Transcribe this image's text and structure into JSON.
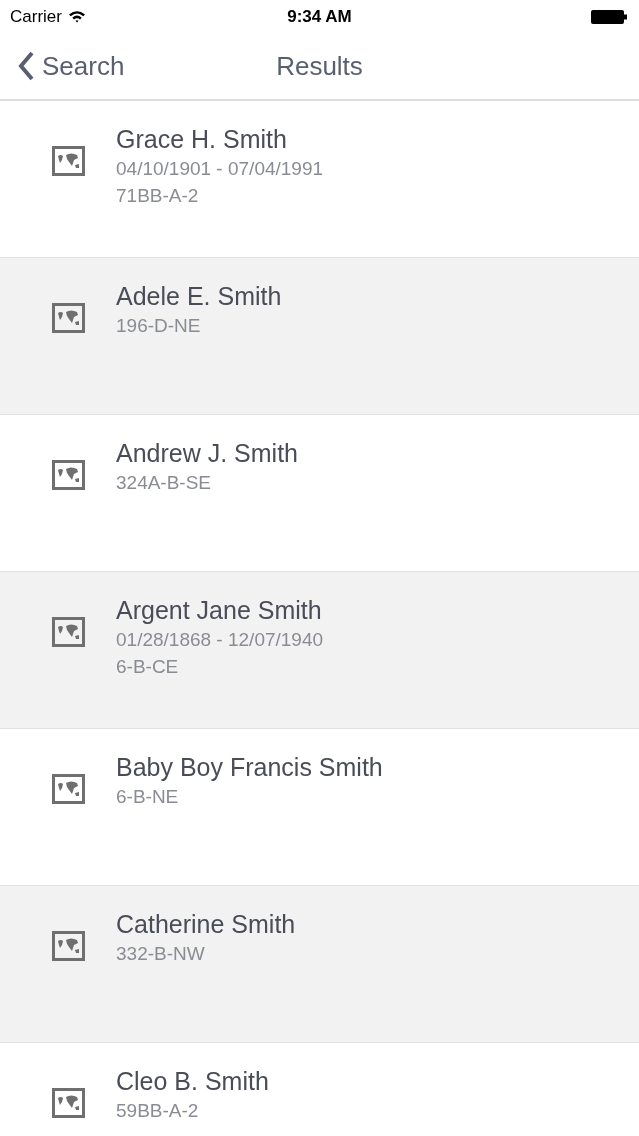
{
  "status_bar": {
    "carrier": "Carrier",
    "time": "9:34 AM"
  },
  "nav": {
    "back": "Search",
    "title": "Results"
  },
  "results": [
    {
      "name": "Grace H. Smith",
      "dates": "04/10/1901 - 07/04/1991",
      "location": "71BB-A-2"
    },
    {
      "name": "Adele E. Smith",
      "location": "196-D-NE"
    },
    {
      "name": "Andrew J. Smith",
      "location": "324A-B-SE"
    },
    {
      "name": "Argent Jane Smith",
      "dates": "01/28/1868 - 12/07/1940",
      "location": "6-B-CE"
    },
    {
      "name": "Baby Boy Francis Smith",
      "location": "6-B-NE"
    },
    {
      "name": "Catherine Smith",
      "location": "332-B-NW"
    },
    {
      "name": "Cleo B. Smith",
      "location": "59BB-A-2"
    }
  ]
}
